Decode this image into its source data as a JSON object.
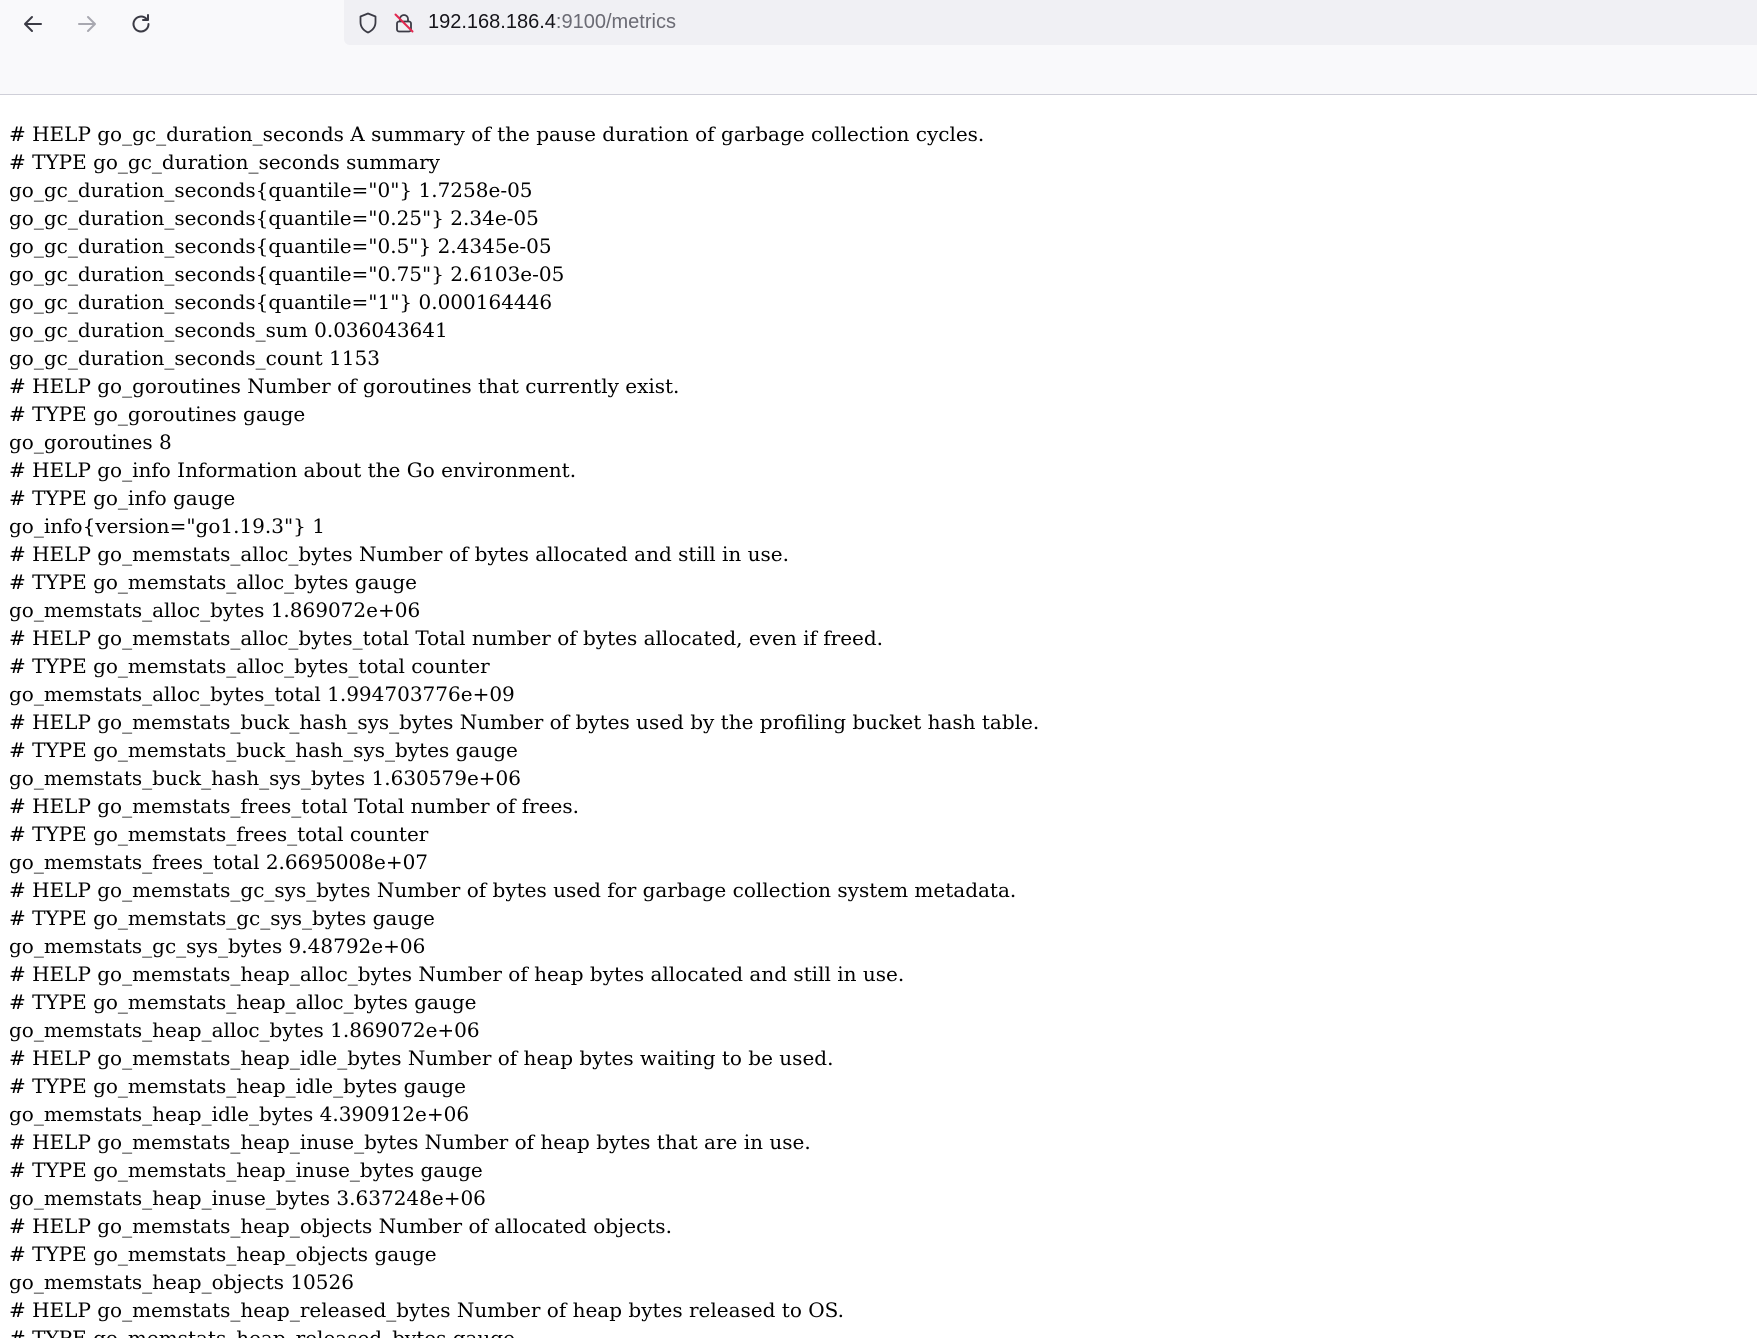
{
  "browser": {
    "url_host": "192.168.186.4",
    "url_rest": ":9100/metrics",
    "icons": {
      "back": "back-arrow-icon",
      "forward": "forward-arrow-icon",
      "reload": "reload-icon",
      "tracking": "shield-icon",
      "security": "insecure-lock-icon"
    }
  },
  "metrics": [
    "# HELP go_gc_duration_seconds A summary of the pause duration of garbage collection cycles.",
    "# TYPE go_gc_duration_seconds summary",
    "go_gc_duration_seconds{quantile=\"0\"} 1.7258e-05",
    "go_gc_duration_seconds{quantile=\"0.25\"} 2.34e-05",
    "go_gc_duration_seconds{quantile=\"0.5\"} 2.4345e-05",
    "go_gc_duration_seconds{quantile=\"0.75\"} 2.6103e-05",
    "go_gc_duration_seconds{quantile=\"1\"} 0.000164446",
    "go_gc_duration_seconds_sum 0.036043641",
    "go_gc_duration_seconds_count 1153",
    "# HELP go_goroutines Number of goroutines that currently exist.",
    "# TYPE go_goroutines gauge",
    "go_goroutines 8",
    "# HELP go_info Information about the Go environment.",
    "# TYPE go_info gauge",
    "go_info{version=\"go1.19.3\"} 1",
    "# HELP go_memstats_alloc_bytes Number of bytes allocated and still in use.",
    "# TYPE go_memstats_alloc_bytes gauge",
    "go_memstats_alloc_bytes 1.869072e+06",
    "# HELP go_memstats_alloc_bytes_total Total number of bytes allocated, even if freed.",
    "# TYPE go_memstats_alloc_bytes_total counter",
    "go_memstats_alloc_bytes_total 1.994703776e+09",
    "# HELP go_memstats_buck_hash_sys_bytes Number of bytes used by the profiling bucket hash table.",
    "# TYPE go_memstats_buck_hash_sys_bytes gauge",
    "go_memstats_buck_hash_sys_bytes 1.630579e+06",
    "# HELP go_memstats_frees_total Total number of frees.",
    "# TYPE go_memstats_frees_total counter",
    "go_memstats_frees_total 2.6695008e+07",
    "# HELP go_memstats_gc_sys_bytes Number of bytes used for garbage collection system metadata.",
    "# TYPE go_memstats_gc_sys_bytes gauge",
    "go_memstats_gc_sys_bytes 9.48792e+06",
    "# HELP go_memstats_heap_alloc_bytes Number of heap bytes allocated and still in use.",
    "# TYPE go_memstats_heap_alloc_bytes gauge",
    "go_memstats_heap_alloc_bytes 1.869072e+06",
    "# HELP go_memstats_heap_idle_bytes Number of heap bytes waiting to be used.",
    "# TYPE go_memstats_heap_idle_bytes gauge",
    "go_memstats_heap_idle_bytes 4.390912e+06",
    "# HELP go_memstats_heap_inuse_bytes Number of heap bytes that are in use.",
    "# TYPE go_memstats_heap_inuse_bytes gauge",
    "go_memstats_heap_inuse_bytes 3.637248e+06",
    "# HELP go_memstats_heap_objects Number of allocated objects.",
    "# TYPE go_memstats_heap_objects gauge",
    "go_memstats_heap_objects 10526",
    "# HELP go_memstats_heap_released_bytes Number of heap bytes released to OS.",
    "# TYPE go_memstats_heap_released_bytes gauge"
  ]
}
